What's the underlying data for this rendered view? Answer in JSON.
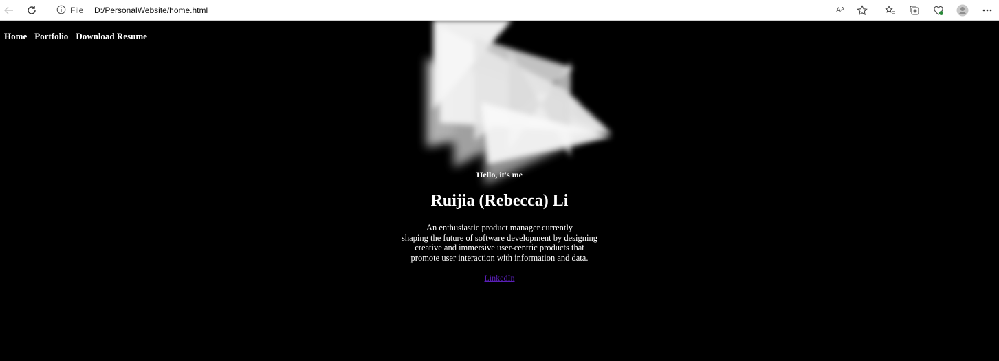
{
  "browser": {
    "file_label": "File",
    "url": "D:/PersonalWebsite/home.html",
    "read_aloud_label": "Aᴬ"
  },
  "nav": {
    "items": [
      "Home",
      "Portfolio",
      "Download Resume"
    ]
  },
  "hero": {
    "greeting": "Hello, it's me",
    "name": "Ruijia (Rebecca) Li",
    "bio_lines": [
      "An enthusiastic product manager currently",
      "shaping the future of software development by designing",
      "creative and immersive user-centric products that",
      "promote user interaction with information and data."
    ],
    "link": "LinkedIn"
  },
  "colors": {
    "page_background": "#000000",
    "text": "#ffffff",
    "link": "#5a1fb8"
  }
}
